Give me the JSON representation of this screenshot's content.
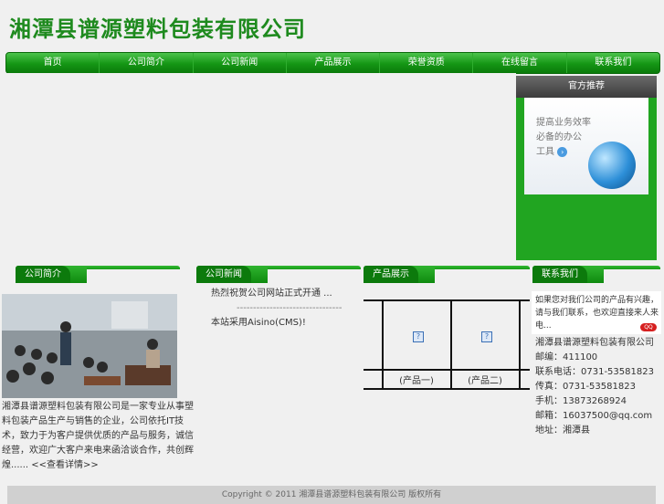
{
  "header": {
    "company": "湘潭县谱源塑料包装有限公司"
  },
  "nav": [
    "首页",
    "公司简介",
    "公司新闻",
    "产品展示",
    "荣誉资质",
    "在线留言",
    "联系我们"
  ],
  "side": {
    "title": "官方推荐",
    "ad_lines": [
      "提高业务效率",
      "必备的办公",
      "工具"
    ]
  },
  "sections": {
    "intro_title": "公司简介",
    "news_title": "公司新闻",
    "products_title": "产品展示",
    "contact_title": "联系我们"
  },
  "intro": {
    "text": "湘潭县谱源塑料包装有限公司是一家专业从事塑料包装产品生产与销售的企业，公司依托IT技术，致力于为客户提供优质的产品与服务，诚信经营，欢迎广大客户来电来函洽谈合作，共创辉煌",
    "more": "...... <<查看详情>>"
  },
  "news": {
    "item1": "热烈祝贺公司网站正式开通 ...",
    "divider": "--------------------------------",
    "item2": "本站采用Aisino(CMS)!"
  },
  "products": {
    "cap1": "(产品一)",
    "cap2": "(产品二)"
  },
  "contact": {
    "box_text": "如果您对我们公司的产品有兴趣，请与我们联系，也欢迎直接来人来电...",
    "qq_badge": "QQ",
    "company": "湘潭县谱源塑料包装有限公司",
    "postcode": "邮编：411100",
    "phone": "联系电话：0731-53581823",
    "fax": "传真：0731-53581823",
    "mobile": "手机：13873268924",
    "email": "邮箱：16037500@qq.com",
    "address": "地址：湘潭县"
  },
  "footer": {
    "copyright": "Copyright © 2011 湘潭县谱源塑料包装有限公司 版权所有"
  }
}
